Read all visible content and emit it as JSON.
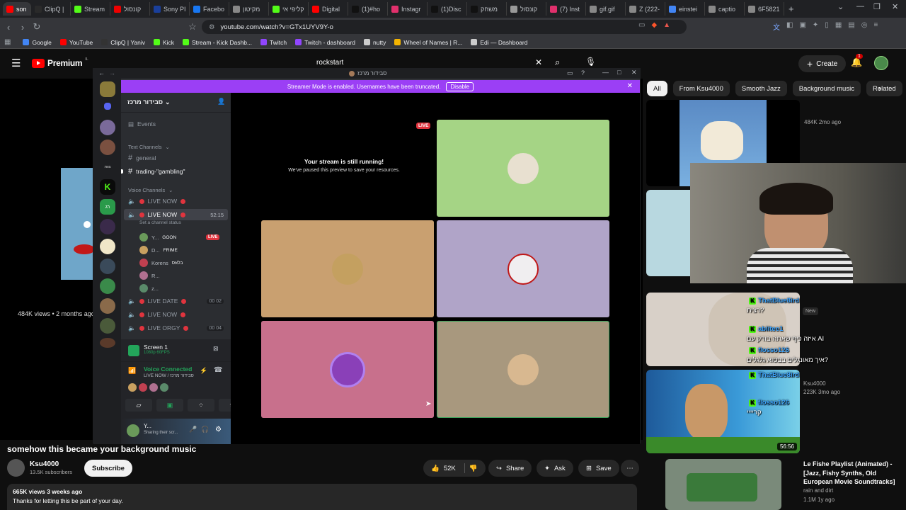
{
  "browser": {
    "tabs": [
      {
        "label": "son",
        "color": "#ff0000",
        "active": true
      },
      {
        "label": "ClipQ |",
        "color": "#2a2a2a"
      },
      {
        "label": "Stream",
        "color": "#53fc18"
      },
      {
        "label": "קונסול",
        "color": "#e00"
      },
      {
        "label": "Sony PI",
        "color": "#1a3f9a"
      },
      {
        "label": "Facebo",
        "color": "#1877f2"
      },
      {
        "label": "מקיטון",
        "color": "#888"
      },
      {
        "label": "קליפי אי",
        "color": "#53fc18"
      },
      {
        "label": "Digital",
        "color": "#ff0000"
      },
      {
        "label": "(1)#ho",
        "color": "#111"
      },
      {
        "label": "Instagr",
        "color": "#e1306c"
      },
      {
        "label": "(1)Disc",
        "color": "#111"
      },
      {
        "label": "משחק",
        "color": "#111"
      },
      {
        "label": "קונסול",
        "color": "#999"
      },
      {
        "label": "(7) Inst",
        "color": "#e1306c"
      },
      {
        "label": "gif.gif",
        "color": "#888"
      },
      {
        "label": "Z (222-",
        "color": "#888"
      },
      {
        "label": "einstei",
        "color": "#4285f4"
      },
      {
        "label": "captio",
        "color": "#888"
      },
      {
        "label": "6F5821",
        "color": "#888"
      }
    ],
    "new_tab": "+",
    "url": "youtube.com/watch?v=GTx1UYV9Y-o",
    "bookmarks": [
      {
        "label": "Google",
        "color": "#4285f4"
      },
      {
        "label": "YouTube",
        "color": "#ff0000"
      },
      {
        "label": "ClipQ | Yaniv",
        "color": "#333"
      },
      {
        "label": "Kick",
        "color": "#53fc18"
      },
      {
        "label": "Stream - Kick Dashb...",
        "color": "#53fc18"
      },
      {
        "label": "Twitch",
        "color": "#9146ff"
      },
      {
        "label": "Twitch - dashboard",
        "color": "#9146ff"
      },
      {
        "label": "nutty",
        "color": "#ccc"
      },
      {
        "label": "Wheel of Names | R...",
        "color": "#f4b400"
      },
      {
        "label": "Edi — Dashboard",
        "color": "#ccc"
      }
    ]
  },
  "youtube": {
    "logo": "Premium",
    "logo_sup": "IL",
    "search_query": "rockstart",
    "create_label": "Create",
    "notif_count": "1",
    "chips": [
      "All",
      "From Ksu4000",
      "Smooth Jazz",
      "Background music",
      "Related"
    ],
    "video_title": "somehow this became your background music",
    "channel_name": "Ksu4000",
    "subscribers": "13.5K subscribers",
    "subscribe_label": "Subscribe",
    "likes": "52K",
    "share_label": "Share",
    "ask_label": "Ask",
    "save_label": "Save",
    "views_line": "665K views  3 weeks ago",
    "description": "Thanks for letting this be part of your day.",
    "left_overlay_meta": "484K views • 2 months ago",
    "recs": [
      {
        "meta": "484K  2mo ago"
      },
      {
        "badge": "New"
      },
      {
        "channel": "Ksu4000",
        "meta": "223K  3mo ago",
        "duration": "56:56"
      },
      {
        "title": "Le Fishe Playlist (Animated) - [Jazz, Fishy Synths, Old European Movie Soundtracks]",
        "channel": "rain and dirt",
        "meta": "1.1M  1y ago"
      }
    ]
  },
  "discord": {
    "window_title": "סבידור מרכז",
    "streamer_notice": "Streamer Mode is enabled. Usernames have been truncated.",
    "disable_label": "Disable",
    "server_name": "סבידור מרכז",
    "events_label": "Events",
    "text_category": "Text Channels",
    "text_channels": [
      "general",
      "trading-\"gambling\""
    ],
    "voice_category": "Voice Channels",
    "voice_channels": [
      {
        "name": "LIVE NOW",
        "timer": ""
      },
      {
        "name": "LIVE NOW",
        "timer": "52:15",
        "status": "Set a channel status"
      },
      {
        "name": "LIVE DATE",
        "timer": "00  02"
      },
      {
        "name": "LIVE NOW",
        "timer": ""
      },
      {
        "name": "LIVE ORGY",
        "timer": "00  04"
      }
    ],
    "voice_users": [
      {
        "name": "Y...",
        "tag": "GOON",
        "color": "#6a9a5a",
        "live": "LIVE"
      },
      {
        "name": "D...",
        "tag": "FRIME",
        "color": "#c9a060"
      },
      {
        "name": "Korens",
        "tag": "בלאס",
        "color": "#c04050"
      },
      {
        "name": "R...",
        "tag": "",
        "color": "#b07090"
      },
      {
        "name": "z...",
        "tag": "",
        "color": "#5a8a6a"
      }
    ],
    "screen_share_label": "Screen 1",
    "screen_share_meta": "1080p 60FPS",
    "voice_connected": "Voice Connected",
    "voice_channel_line": "LIVE NOW / סבידור מרכז",
    "user_name": "Y...",
    "user_status": "Sharing their scr...",
    "live_badge": "LIVE",
    "stream_paused_title": "Your stream is still running!",
    "stream_paused_sub": "We've paused this preview to save your resources.",
    "tiles": [
      {
        "bg": "#a5d485"
      },
      {
        "bg": "#c9a070"
      },
      {
        "bg": "#b0a4c8"
      },
      {
        "bg": "#c8708c"
      },
      {
        "bg": "#a8987e"
      }
    ]
  },
  "webcam_chat": [
    {
      "user": "ThatBlue8ird",
      "text": "רצית?"
    },
    {
      "user": "ablitee1",
      "text": "איזה כיף שאתה בודק עם AI"
    },
    {
      "user": "flosso126",
      "text": "איך מאונגלים בבסוא גלגלים?"
    },
    {
      "user": "ThatBlue8ird",
      "text": ""
    },
    {
      "user": "flosso126",
      "text": "קריייי"
    }
  ],
  "colors": {
    "yt_bg": "#0f0f0f",
    "discord_bg": "#313338",
    "streamer_purple": "#9b3ff5",
    "kick_green": "#53fc18",
    "live_red": "#e0343e"
  }
}
